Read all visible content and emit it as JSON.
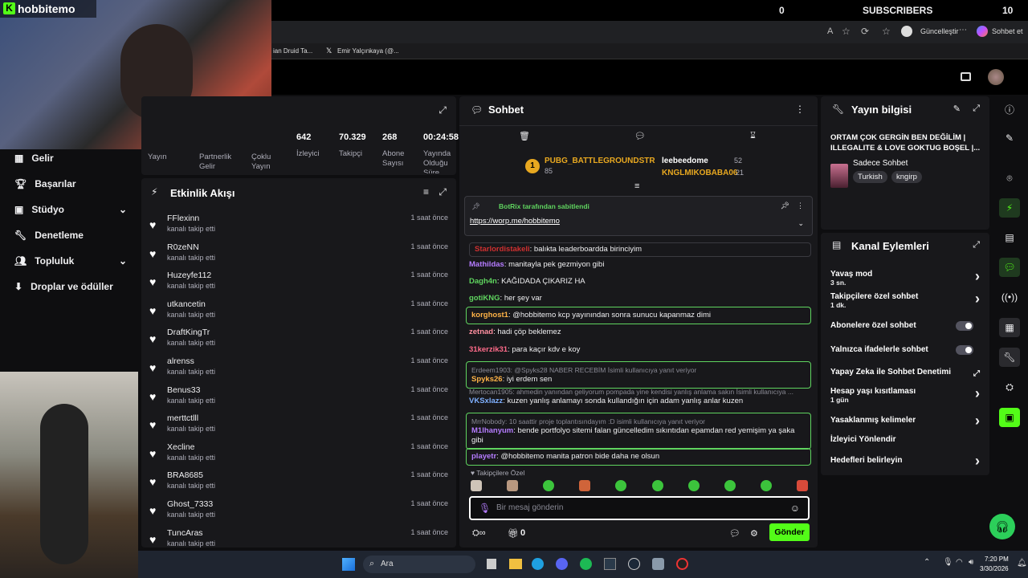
{
  "overlay": {
    "logo": "hobbitemo",
    "counter": "0",
    "subscribers_label": "SUBSCRIBERS",
    "sub_count": "10"
  },
  "browser": {
    "update_label": "Güncelleştir",
    "chat_label": "Sohbet et",
    "tab1": "ian Druid Ta...",
    "tab2": "Emir Yalçınkaya (@..."
  },
  "nav": {
    "items": [
      "Gelir",
      "Başarılar",
      "Stüdyo",
      "Denetleme",
      "Topluluk",
      "Droplar ve ödüller"
    ]
  },
  "stats": {
    "values": [
      "642",
      "70.329",
      "268",
      "00:24:58"
    ],
    "labels": [
      "İzleyici",
      "Takipçi",
      "Abone Sayısı",
      "Yayında Olduğu Süre"
    ],
    "left_labels": [
      "Yayın",
      "Partnerlik Gelir",
      "Çoklu Yayın"
    ]
  },
  "feed": {
    "title": "Etkinlik Akışı",
    "items": [
      {
        "name": "FFlexinn",
        "sub": "kanalı takip etti",
        "time": "1 saat önce"
      },
      {
        "name": "R0zeNN",
        "sub": "kanalı takip etti",
        "time": "1 saat önce"
      },
      {
        "name": "Huzeyfe112",
        "sub": "kanalı takip etti",
        "time": "1 saat önce"
      },
      {
        "name": "utkancetin",
        "sub": "kanalı takip etti",
        "time": "1 saat önce"
      },
      {
        "name": "DraftKingTr",
        "sub": "kanalı takip etti",
        "time": "1 saat önce"
      },
      {
        "name": "alrenss",
        "sub": "kanalı takip etti",
        "time": "1 saat önce"
      },
      {
        "name": "Benus33",
        "sub": "kanalı takip etti",
        "time": "1 saat önce"
      },
      {
        "name": "merttctlll",
        "sub": "kanalı takip etti",
        "time": "1 saat önce"
      },
      {
        "name": "Xecline",
        "sub": "kanalı takip etti",
        "time": "1 saat önce"
      },
      {
        "name": "BRA8685",
        "sub": "kanalı takip etti",
        "time": "1 saat önce"
      },
      {
        "name": "Ghost_7333",
        "sub": "kanalı takip etti",
        "time": "1 saat önce"
      },
      {
        "name": "TuncAras",
        "sub": "kanalı takip etti",
        "time": "1 saat önce"
      }
    ]
  },
  "chat": {
    "title": "Sohbet",
    "leader1": {
      "name": "PUBG_BATTLEGROUNDSTR",
      "count": "85"
    },
    "leader2": {
      "name": "leebeedome",
      "count": "52"
    },
    "leader3": {
      "name": "KNGLMIKOBABA06",
      "count": "21"
    },
    "pinned_by": "BotRix tarafından sabitlendi",
    "pinned_link": "https://worp.me/hobbitemo",
    "messages": [
      {
        "user": "Starlordistakeli",
        "text": "balıkta leaderboardda birinciyim",
        "color": "#d03030"
      },
      {
        "user": "Mathildas",
        "text": "manitayla pek gezmiyon gibi",
        "color": "#b57cff"
      },
      {
        "user": "Dagh4n",
        "text": "KAĞIDADA ÇIKARIZ HA",
        "color": "#5fd45f"
      },
      {
        "user": "gotiKNG",
        "text": "her şey var",
        "color": "#5fd45f"
      },
      {
        "user": "korghost1",
        "text": "@hobbitemo kcp yayınından sonra sunucu kapanmaz dimi",
        "color": "#ffb347"
      },
      {
        "user": "zetnad",
        "text": "hadi çöp beklemez",
        "color": "#ff8fa0"
      },
      {
        "user": "31kerzik31",
        "text": "para kaçır kdv e koy",
        "color": "#ff6b8a"
      },
      {
        "reply": "Erdeem1903: @Spyks28 NABER RECEBİM İsimli kullanıcıya yanıt veriyor",
        "user": "Spyks26",
        "text": "iyi erdem sen",
        "color": "#ffb347"
      },
      {
        "reply": "Mertocan1905: ahmedin yanından geliyorum pompada yine kendisi yanlış anlama sakın İsimli kullanıcıya ...",
        "user": "VKSxlazz",
        "text": "kuzen yanlış anlamayı sonda kullandığın için adam yanlış anlar kuzen",
        "color": "#7fb0ff"
      },
      {
        "reply": "MrrNobody: 10 saattir proje toplantısındayım :D isimli kullanıcıya yanıt veriyor",
        "user": "M1lhanyum",
        "text": "bende portfolyo sitemi falan güncelledim sıkıntıdan epamdan red yemişim ya şaka gibi",
        "color": "#b57cff"
      },
      {
        "user": "playetr",
        "text": "@hobbitemo manita patron bide daha ne olsun",
        "color": "#b57cff"
      }
    ],
    "followers_only": "Takipçilere Özel",
    "input_placeholder": "Bir mesaj gönderin",
    "points": "0",
    "send_label": "Gönder"
  },
  "info": {
    "title": "Yayın bilgisi",
    "stream_title": "ORTAM ÇOK GERGİN BEN DEĞİLİM | ILLEGALITE & LOVE GOKTUG BOŞEL |...",
    "category": "Sadece Sohbet",
    "tags": [
      "Turkish",
      "kngirp"
    ]
  },
  "actions": {
    "title": "Kanal Eylemleri",
    "items": [
      {
        "label": "Yavaş mod",
        "sub": "3 sn.",
        "kind": "chev"
      },
      {
        "label": "Takipçilere özel sohbet",
        "sub": "1 dk.",
        "kind": "chev"
      },
      {
        "label": "Abonelere özel sohbet",
        "sub": "",
        "kind": "toggle"
      },
      {
        "label": "Yalnızca ifadelerle sohbet",
        "sub": "",
        "kind": "toggle"
      },
      {
        "label": "Yapay Zeka ile Sohbet Denetimi",
        "sub": "",
        "kind": "ext"
      },
      {
        "label": "Hesap yaşı kısıtlaması",
        "sub": "1 gün",
        "kind": "chev"
      },
      {
        "label": "Yasaklanmış kelimeler",
        "sub": "",
        "kind": "chev"
      },
      {
        "label": "İzleyici Yönlendir",
        "sub": "",
        "kind": "none"
      },
      {
        "label": "Hedefleri belirleyin",
        "sub": "",
        "kind": "chev"
      }
    ]
  },
  "taskbar": {
    "search": "Ara",
    "time": "7:20 PM",
    "date": "3/30/2026"
  },
  "colors": {
    "accent": "#53fc18",
    "panel": "#18181b",
    "bg": "#0e0e10"
  }
}
